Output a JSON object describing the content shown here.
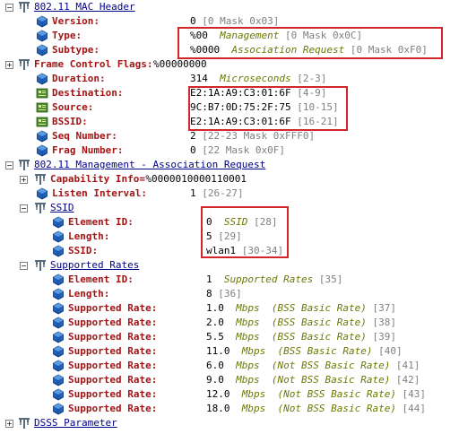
{
  "rows": [
    {
      "depth": 0,
      "kind": "group",
      "expander": "−",
      "label": "802.11 MAC Header",
      "value": []
    },
    {
      "depth": 1,
      "kind": "field",
      "label": "Version:",
      "value": [
        {
          "t": "0 ",
          "c": "val"
        },
        {
          "t": "[0 Mask 0x03]",
          "c": "ofs"
        }
      ]
    },
    {
      "depth": 1,
      "kind": "field",
      "label": "Type:",
      "value": [
        {
          "t": "%00  ",
          "c": "val"
        },
        {
          "t": "Management",
          "c": "em"
        },
        {
          "t": " [0 Mask 0x0C]",
          "c": "ofs"
        }
      ]
    },
    {
      "depth": 1,
      "kind": "field",
      "label": "Subtype:",
      "value": [
        {
          "t": "%0000  ",
          "c": "val"
        },
        {
          "t": "Association Request",
          "c": "em"
        },
        {
          "t": " [0 Mask 0xF0]",
          "c": "ofs"
        }
      ]
    },
    {
      "depth": 0,
      "kind": "subgroup",
      "expander": "+",
      "label": "Frame Control Flags:",
      "value": [
        {
          "t": "%00000000",
          "c": "val"
        }
      ]
    },
    {
      "depth": 1,
      "kind": "field",
      "label": "Duration:",
      "value": [
        {
          "t": "314  ",
          "c": "val"
        },
        {
          "t": "Microseconds",
          "c": "em"
        },
        {
          "t": " [2-3]",
          "c": "ofs"
        }
      ]
    },
    {
      "depth": 1,
      "kind": "addr",
      "label": "Destination:",
      "value": [
        {
          "t": "E2:1A:A9:C3:01:6F ",
          "c": "val"
        },
        {
          "t": "[4-9]",
          "c": "ofs"
        }
      ]
    },
    {
      "depth": 1,
      "kind": "addr",
      "label": "Source:",
      "value": [
        {
          "t": "9C:B7:0D:75:2F:75 ",
          "c": "val"
        },
        {
          "t": "[10-15]",
          "c": "ofs"
        }
      ]
    },
    {
      "depth": 1,
      "kind": "addr",
      "label": "BSSID:",
      "value": [
        {
          "t": "E2:1A:A9:C3:01:6F ",
          "c": "val"
        },
        {
          "t": "[16-21]",
          "c": "ofs"
        }
      ]
    },
    {
      "depth": 1,
      "kind": "field",
      "label": "Seq Number:",
      "value": [
        {
          "t": "2 ",
          "c": "val"
        },
        {
          "t": "[22-23 Mask 0xFFF0]",
          "c": "ofs"
        }
      ]
    },
    {
      "depth": 1,
      "kind": "field",
      "label": "Frag Number:",
      "value": [
        {
          "t": "0 ",
          "c": "val"
        },
        {
          "t": "[22 Mask 0x0F]",
          "c": "ofs"
        }
      ]
    },
    {
      "depth": 0,
      "kind": "group",
      "expander": "−",
      "label": "802.11 Management - Association Request",
      "value": []
    },
    {
      "depth": 1,
      "kind": "subgroup",
      "expander": "+",
      "label": "Capability Info=",
      "value": [
        {
          "t": "%0000010000110001",
          "c": "val"
        }
      ]
    },
    {
      "depth": 1,
      "kind": "field",
      "label": "Listen Interval:",
      "value": [
        {
          "t": "1 ",
          "c": "val"
        },
        {
          "t": "[26-27]",
          "c": "ofs"
        }
      ]
    },
    {
      "depth": 1,
      "kind": "group",
      "expander": "−",
      "label": "SSID",
      "value": []
    },
    {
      "depth": 2,
      "kind": "field",
      "label": "Element ID:",
      "value": [
        {
          "t": "0  ",
          "c": "val"
        },
        {
          "t": "SSID",
          "c": "em"
        },
        {
          "t": " [28]",
          "c": "ofs"
        }
      ]
    },
    {
      "depth": 2,
      "kind": "field",
      "label": "Length:",
      "value": [
        {
          "t": "5 ",
          "c": "val"
        },
        {
          "t": "[29]",
          "c": "ofs"
        }
      ]
    },
    {
      "depth": 2,
      "kind": "field",
      "label": "SSID:",
      "value": [
        {
          "t": "wlan1 ",
          "c": "val"
        },
        {
          "t": "[30-34]",
          "c": "ofs"
        }
      ]
    },
    {
      "depth": 1,
      "kind": "group",
      "expander": "−",
      "label": "Supported Rates",
      "value": []
    },
    {
      "depth": 2,
      "kind": "field",
      "label": "Element ID:",
      "value": [
        {
          "t": "1  ",
          "c": "val"
        },
        {
          "t": "Supported Rates",
          "c": "em"
        },
        {
          "t": " [35]",
          "c": "ofs"
        }
      ]
    },
    {
      "depth": 2,
      "kind": "field",
      "label": "Length:",
      "value": [
        {
          "t": "8 ",
          "c": "val"
        },
        {
          "t": "[36]",
          "c": "ofs"
        }
      ]
    },
    {
      "depth": 2,
      "kind": "field",
      "label": "Supported Rate:",
      "value": [
        {
          "t": "1.0  ",
          "c": "val"
        },
        {
          "t": "Mbps  (BSS Basic Rate)",
          "c": "em"
        },
        {
          "t": " [37]",
          "c": "ofs"
        }
      ]
    },
    {
      "depth": 2,
      "kind": "field",
      "label": "Supported Rate:",
      "value": [
        {
          "t": "2.0  ",
          "c": "val"
        },
        {
          "t": "Mbps  (BSS Basic Rate)",
          "c": "em"
        },
        {
          "t": " [38]",
          "c": "ofs"
        }
      ]
    },
    {
      "depth": 2,
      "kind": "field",
      "label": "Supported Rate:",
      "value": [
        {
          "t": "5.5  ",
          "c": "val"
        },
        {
          "t": "Mbps  (BSS Basic Rate)",
          "c": "em"
        },
        {
          "t": " [39]",
          "c": "ofs"
        }
      ]
    },
    {
      "depth": 2,
      "kind": "field",
      "label": "Supported Rate:",
      "value": [
        {
          "t": "11.0  ",
          "c": "val"
        },
        {
          "t": "Mbps  (BSS Basic Rate)",
          "c": "em"
        },
        {
          "t": " [40]",
          "c": "ofs"
        }
      ]
    },
    {
      "depth": 2,
      "kind": "field",
      "label": "Supported Rate:",
      "value": [
        {
          "t": "6.0  ",
          "c": "val"
        },
        {
          "t": "Mbps  (Not BSS Basic Rate)",
          "c": "em"
        },
        {
          "t": " [41]",
          "c": "ofs"
        }
      ]
    },
    {
      "depth": 2,
      "kind": "field",
      "label": "Supported Rate:",
      "value": [
        {
          "t": "9.0  ",
          "c": "val"
        },
        {
          "t": "Mbps  (Not BSS Basic Rate)",
          "c": "em"
        },
        {
          "t": " [42]",
          "c": "ofs"
        }
      ]
    },
    {
      "depth": 2,
      "kind": "field",
      "label": "Supported Rate:",
      "value": [
        {
          "t": "12.0  ",
          "c": "val"
        },
        {
          "t": "Mbps  (Not BSS Basic Rate)",
          "c": "em"
        },
        {
          "t": " [43]",
          "c": "ofs"
        }
      ]
    },
    {
      "depth": 2,
      "kind": "field",
      "label": "Supported Rate:",
      "value": [
        {
          "t": "18.0  ",
          "c": "val"
        },
        {
          "t": "Mbps  (Not BSS Basic Rate)",
          "c": "em"
        },
        {
          "t": " [44]",
          "c": "ofs"
        }
      ]
    },
    {
      "depth": 0,
      "kind": "group",
      "expander": "+",
      "label": "DSSS Parameter",
      "value": []
    }
  ],
  "icons": {
    "group": "protocol-tree-icon",
    "subgroup": "protocol-tree-icon",
    "field": "field-icon",
    "addr": "address-card-icon"
  },
  "colors": {
    "label": "#a31515",
    "group_label": "#00008b",
    "emphasis": "#6e7800",
    "offset": "#808080",
    "highlight_box": "#d0262c",
    "field_icon": "#1f5fb8",
    "address_icon": "#4e8a2a",
    "tree_icon": "#5a6c7a"
  }
}
